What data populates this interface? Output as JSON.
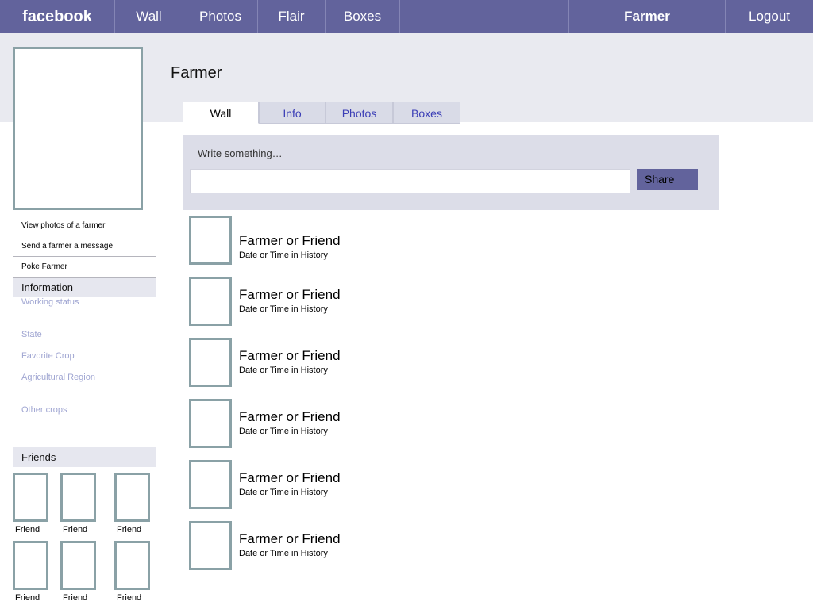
{
  "topbar": {
    "logo": "facebook",
    "nav": [
      "Wall",
      "Photos",
      "Flair",
      "Boxes"
    ],
    "user": "Farmer",
    "logout": "Logout"
  },
  "profile": {
    "name": "Farmer",
    "tabs": [
      "Wall",
      "Info",
      "Photos",
      "Boxes"
    ],
    "active_tab": "Wall"
  },
  "sidebar": {
    "actions": [
      "View photos of a farmer",
      "Send a farmer a message",
      "Poke Farmer"
    ],
    "information": {
      "header": "Information",
      "fields": [
        "Working status",
        "State",
        "Favorite Crop",
        "Agricultural Region",
        "Other crops"
      ]
    },
    "friends": {
      "header": "Friends",
      "items": [
        "Friend",
        "Friend",
        "Friend",
        "Friend",
        "Friend",
        "Friend"
      ]
    }
  },
  "composer": {
    "label": "Write something…",
    "value": "",
    "share_label": "Share"
  },
  "posts": [
    {
      "author": "Farmer or Friend",
      "date": "Date or Time in History"
    },
    {
      "author": "Farmer or Friend",
      "date": "Date or Time in History"
    },
    {
      "author": "Farmer or Friend",
      "date": "Date or Time in History"
    },
    {
      "author": "Farmer or Friend",
      "date": "Date or Time in History"
    },
    {
      "author": "Farmer or Friend",
      "date": "Date or Time in History"
    },
    {
      "author": "Farmer or Friend",
      "date": "Date or Time in History"
    }
  ],
  "colors": {
    "topbar": "#62639c",
    "header_band": "#e9eaf0",
    "composer_bg": "#dcdde8",
    "tab_inactive_text": "#3b3eb6",
    "info_field_text": "#a0a6d2",
    "photo_border": "#8aa1a6"
  }
}
